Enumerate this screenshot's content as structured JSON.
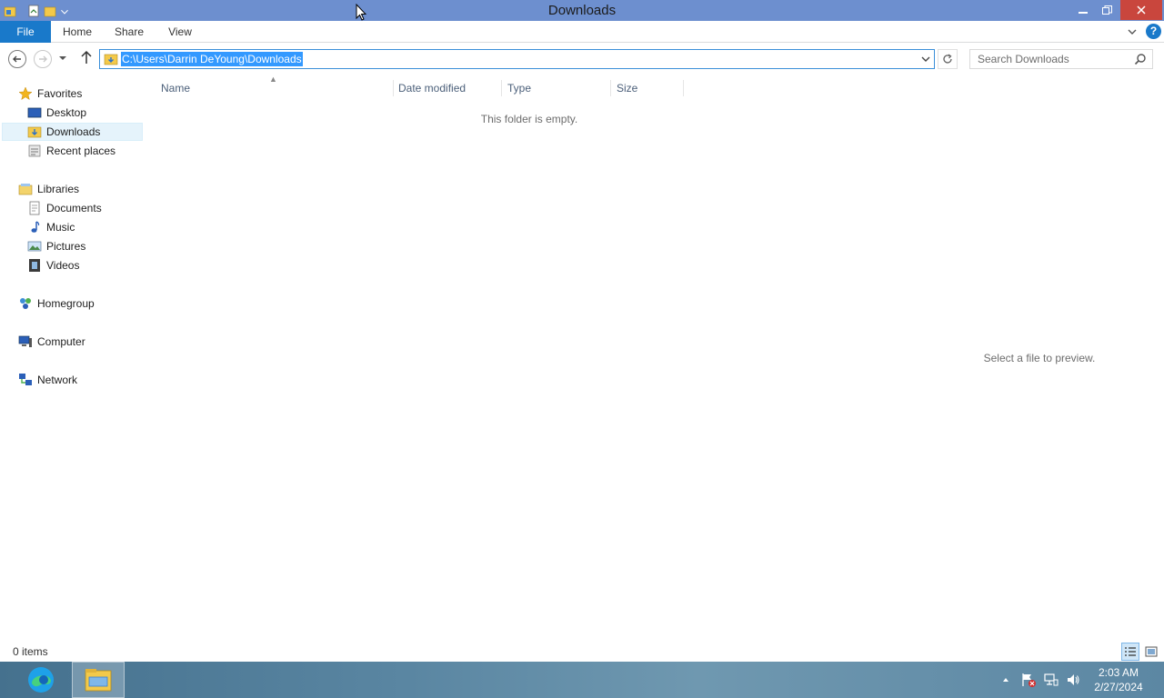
{
  "window": {
    "title": "Downloads"
  },
  "ribbon": {
    "tabs": [
      {
        "label": "File"
      },
      {
        "label": "Home"
      },
      {
        "label": "Share"
      },
      {
        "label": "View"
      }
    ],
    "help_label": "?"
  },
  "address": {
    "path": "C:\\Users\\Darrin DeYoung\\Downloads"
  },
  "search": {
    "placeholder": "Search Downloads"
  },
  "nav": {
    "favorites": {
      "label": "Favorites",
      "items": [
        {
          "label": "Desktop"
        },
        {
          "label": "Downloads",
          "selected": true
        },
        {
          "label": "Recent places"
        }
      ]
    },
    "libraries": {
      "label": "Libraries",
      "items": [
        {
          "label": "Documents"
        },
        {
          "label": "Music"
        },
        {
          "label": "Pictures"
        },
        {
          "label": "Videos"
        }
      ]
    },
    "homegroup": {
      "label": "Homegroup"
    },
    "computer": {
      "label": "Computer"
    },
    "network": {
      "label": "Network"
    }
  },
  "file_list": {
    "columns": [
      "Name",
      "Date modified",
      "Type",
      "Size"
    ],
    "sorted_by": "Name",
    "empty_message": "This folder is empty.",
    "items": []
  },
  "preview_pane": {
    "message": "Select a file to preview."
  },
  "status_bar": {
    "item_count": "0 items",
    "active_view": "details"
  },
  "taskbar": {
    "apps": [
      {
        "name": "edge-icon"
      },
      {
        "name": "file-explorer-icon",
        "active": true
      }
    ],
    "clock": {
      "time": "2:03 AM",
      "date": "2/27/2024"
    }
  },
  "colors": {
    "titlebar": "#6d8fcf",
    "file_tab": "#1979ca",
    "close_button": "#c9463d",
    "selection": "#3399ff",
    "nav_selected": "#e5f3fb"
  }
}
